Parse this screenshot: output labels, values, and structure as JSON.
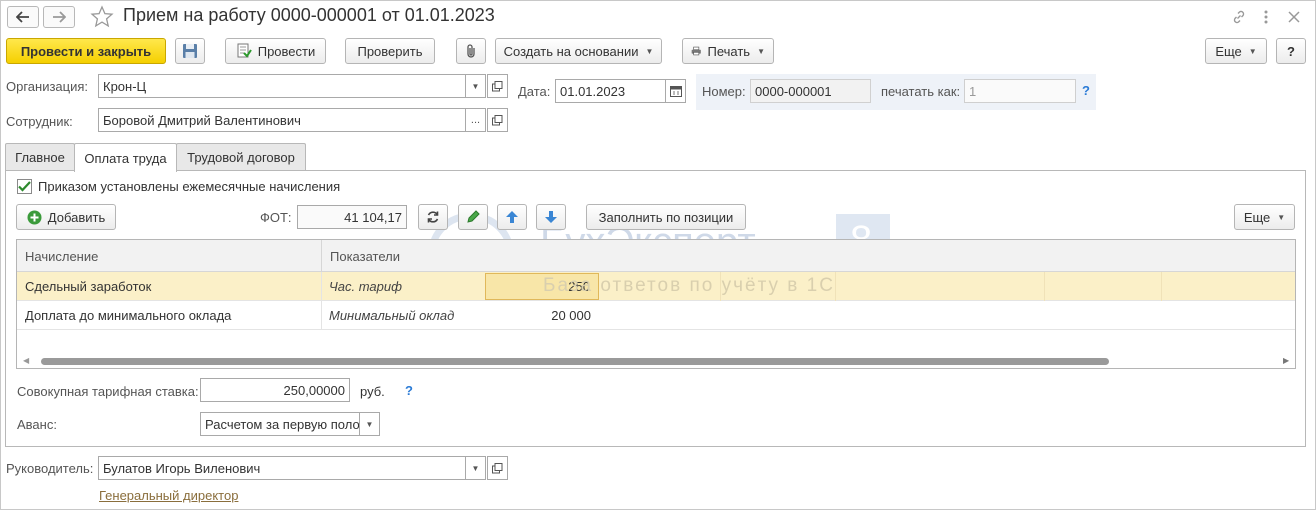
{
  "window": {
    "title": "Прием на работу 0000-000001 от 01.01.2023"
  },
  "toolbar": {
    "post_close": "Провести и закрыть",
    "post": "Провести",
    "check": "Проверить",
    "create_based": "Создать на основании",
    "print": "Печать",
    "more": "Еще",
    "help": "?"
  },
  "header": {
    "org_label": "Организация:",
    "org_value": "Крон-Ц",
    "date_label": "Дата:",
    "date_value": "01.01.2023",
    "number_label": "Номер:",
    "number_value": "0000-000001",
    "print_as_label": "печатать как:",
    "print_as_value": "1",
    "employee_label": "Сотрудник:",
    "employee_value": "Боровой Дмитрий Валентинович",
    "help": "?"
  },
  "tabs": [
    {
      "label": "Главное"
    },
    {
      "label": "Оплата труда"
    },
    {
      "label": "Трудовой договор"
    }
  ],
  "pay": {
    "checkbox_label": "Приказом установлены ежемесячные начисления",
    "checkbox_checked": true,
    "add_button": "Добавить",
    "fot_label": "ФОТ:",
    "fot_value": "41 104,17",
    "fill_button": "Заполнить по позиции",
    "more_button": "Еще",
    "columns": [
      "Начисление",
      "Показатели"
    ],
    "rows": [
      {
        "name": "Сдельный заработок",
        "indicator": "Час. тариф",
        "value": "250"
      },
      {
        "name": "Доплата до минимального оклада",
        "indicator": "Минимальный оклад",
        "value": "20 000"
      }
    ],
    "rate_label": "Совокупная тарифная ставка:",
    "rate_value": "250,00000",
    "rate_unit": "руб.",
    "rate_help": "?",
    "advance_label": "Аванс:",
    "advance_value": "Расчетом за первую поло"
  },
  "footer": {
    "manager_label": "Руководитель:",
    "manager_value": "Булатов Игорь Виленович",
    "position_link": "Генеральный директор"
  },
  "watermark": {
    "brand": "БухЭксперт",
    "digit": "8",
    "tagline": "База ответов по учёту в 1С"
  }
}
